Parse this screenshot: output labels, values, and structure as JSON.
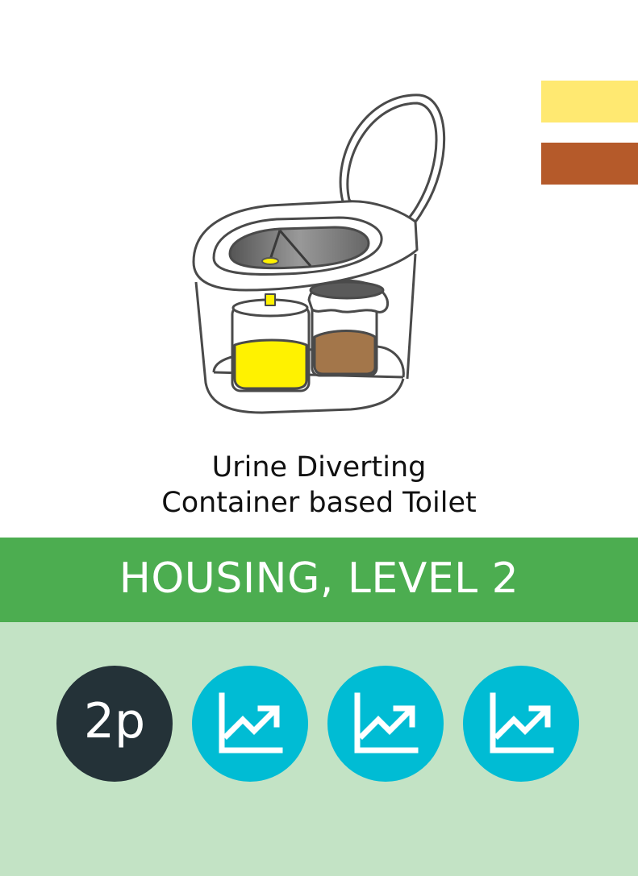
{
  "title": {
    "line1": "Urine Diverting",
    "line2": "Container based Toilet"
  },
  "banner": {
    "label": "HOUSING, LEVEL 2"
  },
  "badges": {
    "people": "2p",
    "icons": [
      "trend-up-icon",
      "trend-up-icon",
      "trend-up-icon"
    ]
  },
  "colors": {
    "urine_swatch": "#ffe971",
    "feces_swatch": "#b55a2a",
    "banner_bg": "#4cad50",
    "lower_bg": "#c3e3c5",
    "people_badge": "#243238",
    "trend_badge": "#00bcd4"
  }
}
